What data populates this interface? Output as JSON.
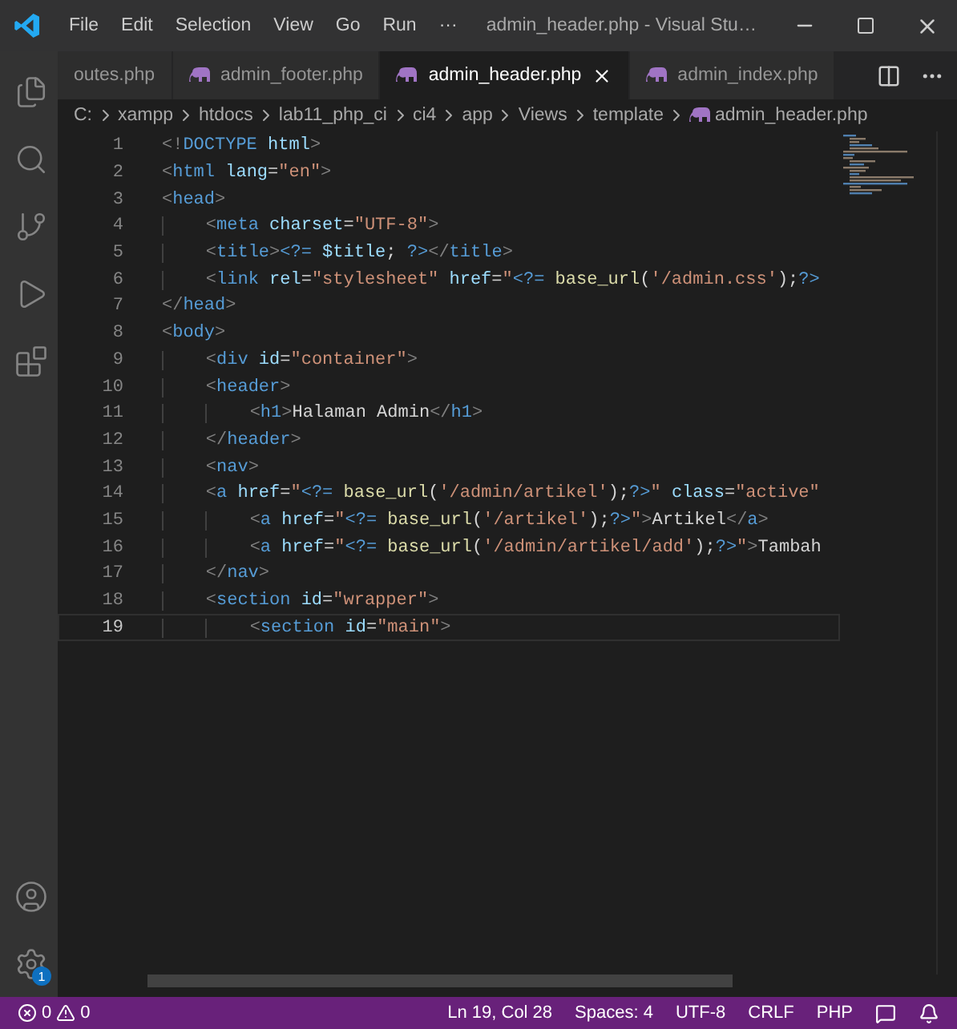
{
  "menu": [
    "File",
    "Edit",
    "Selection",
    "View",
    "Go",
    "Run",
    "···"
  ],
  "window": {
    "title": "admin_header.php - Visual Stu…"
  },
  "activity_bar": {
    "top": [
      {
        "kind": "files",
        "selected": false
      },
      {
        "kind": "search",
        "selected": false
      },
      {
        "kind": "source-control",
        "selected": false
      },
      {
        "kind": "run",
        "selected": false
      },
      {
        "kind": "extensions",
        "selected": false
      }
    ],
    "bottom": [
      {
        "kind": "account"
      },
      {
        "kind": "settings",
        "badge": "1"
      }
    ]
  },
  "tabs": [
    {
      "label": "outes.php",
      "icon": false,
      "selected": false
    },
    {
      "label": "admin_footer.php",
      "icon": true,
      "selected": false
    },
    {
      "label": "admin_header.php",
      "icon": true,
      "selected": true
    },
    {
      "label": "admin_index.php",
      "icon": true,
      "selected": false
    }
  ],
  "breadcrumb": [
    "C:",
    "xampp",
    "htdocs",
    "lab11_php_ci",
    "ci4",
    "app",
    "Views",
    "template",
    "admin_header.php"
  ],
  "lines": [
    {
      "number": "1",
      "selected": false,
      "tokens": [
        {
          "kind": "punct",
          "text": "<!"
        },
        {
          "kind": "tag",
          "text": "DOCTYPE"
        },
        {
          "kind": "attr",
          "text": " html"
        },
        {
          "kind": "punct",
          "text": ">"
        }
      ]
    },
    {
      "number": "2",
      "selected": false,
      "tokens": [
        {
          "kind": "punct",
          "text": "<"
        },
        {
          "kind": "tag",
          "text": "html"
        },
        {
          "kind": "attr",
          "text": " lang"
        },
        {
          "kind": "text",
          "text": "="
        },
        {
          "kind": "str",
          "text": "\"en\""
        },
        {
          "kind": "punct",
          "text": ">"
        }
      ]
    },
    {
      "number": "3",
      "selected": false,
      "tokens": [
        {
          "kind": "punct",
          "text": "<"
        },
        {
          "kind": "tag",
          "text": "head"
        },
        {
          "kind": "punct",
          "text": ">"
        }
      ]
    },
    {
      "number": "4",
      "selected": false,
      "tokens": [
        {
          "kind": "punct",
          "text": "    <"
        },
        {
          "kind": "tag",
          "text": "meta"
        },
        {
          "kind": "attr",
          "text": " charset"
        },
        {
          "kind": "text",
          "text": "="
        },
        {
          "kind": "str",
          "text": "\"UTF-8\""
        },
        {
          "kind": "punct",
          "text": ">"
        }
      ]
    },
    {
      "number": "5",
      "selected": false,
      "tokens": [
        {
          "kind": "punct",
          "text": "    <"
        },
        {
          "kind": "tag",
          "text": "title"
        },
        {
          "kind": "punct",
          "text": ">"
        },
        {
          "kind": "php",
          "text": "<?="
        },
        {
          "kind": "attr",
          "text": " $title"
        },
        {
          "kind": "text",
          "text": ";"
        },
        {
          "kind": "php",
          "text": " ?>"
        },
        {
          "kind": "punct",
          "text": "</"
        },
        {
          "kind": "tag",
          "text": "title"
        },
        {
          "kind": "punct",
          "text": ">"
        }
      ]
    },
    {
      "number": "6",
      "selected": false,
      "tokens": [
        {
          "kind": "punct",
          "text": "    <"
        },
        {
          "kind": "tag",
          "text": "link"
        },
        {
          "kind": "attr",
          "text": " rel"
        },
        {
          "kind": "text",
          "text": "="
        },
        {
          "kind": "str",
          "text": "\"stylesheet\""
        },
        {
          "kind": "attr",
          "text": " href"
        },
        {
          "kind": "text",
          "text": "="
        },
        {
          "kind": "str",
          "text": "\""
        },
        {
          "kind": "php",
          "text": "<?="
        },
        {
          "kind": "func",
          "text": " base_url"
        },
        {
          "kind": "text",
          "text": "("
        },
        {
          "kind": "str",
          "text": "'/admin.css'"
        },
        {
          "kind": "text",
          "text": ");"
        },
        {
          "kind": "php",
          "text": "?>"
        }
      ]
    },
    {
      "number": "7",
      "selected": false,
      "tokens": [
        {
          "kind": "punct",
          "text": "</"
        },
        {
          "kind": "tag",
          "text": "head"
        },
        {
          "kind": "punct",
          "text": ">"
        }
      ]
    },
    {
      "number": "8",
      "selected": false,
      "tokens": [
        {
          "kind": "punct",
          "text": "<"
        },
        {
          "kind": "tag",
          "text": "body"
        },
        {
          "kind": "punct",
          "text": ">"
        }
      ]
    },
    {
      "number": "9",
      "selected": false,
      "tokens": [
        {
          "kind": "punct",
          "text": "    <"
        },
        {
          "kind": "tag",
          "text": "div"
        },
        {
          "kind": "attr",
          "text": " id"
        },
        {
          "kind": "text",
          "text": "="
        },
        {
          "kind": "str",
          "text": "\"container\""
        },
        {
          "kind": "punct",
          "text": ">"
        }
      ]
    },
    {
      "number": "10",
      "selected": false,
      "tokens": [
        {
          "kind": "punct",
          "text": "    <"
        },
        {
          "kind": "tag",
          "text": "header"
        },
        {
          "kind": "punct",
          "text": ">"
        }
      ]
    },
    {
      "number": "11",
      "selected": false,
      "tokens": [
        {
          "kind": "punct",
          "text": "        <"
        },
        {
          "kind": "tag",
          "text": "h1"
        },
        {
          "kind": "punct",
          "text": ">"
        },
        {
          "kind": "text",
          "text": "Halaman Admin"
        },
        {
          "kind": "punct",
          "text": "</"
        },
        {
          "kind": "tag",
          "text": "h1"
        },
        {
          "kind": "punct",
          "text": ">"
        }
      ]
    },
    {
      "number": "12",
      "selected": false,
      "tokens": [
        {
          "kind": "punct",
          "text": "    </"
        },
        {
          "kind": "tag",
          "text": "header"
        },
        {
          "kind": "punct",
          "text": ">"
        }
      ]
    },
    {
      "number": "13",
      "selected": false,
      "tokens": [
        {
          "kind": "punct",
          "text": "    <"
        },
        {
          "kind": "tag",
          "text": "nav"
        },
        {
          "kind": "punct",
          "text": ">"
        }
      ]
    },
    {
      "number": "14",
      "selected": false,
      "tokens": [
        {
          "kind": "punct",
          "text": "    <"
        },
        {
          "kind": "tag",
          "text": "a"
        },
        {
          "kind": "attr",
          "text": " href"
        },
        {
          "kind": "text",
          "text": "="
        },
        {
          "kind": "str",
          "text": "\""
        },
        {
          "kind": "php",
          "text": "<?="
        },
        {
          "kind": "func",
          "text": " base_url"
        },
        {
          "kind": "text",
          "text": "("
        },
        {
          "kind": "str",
          "text": "'/admin/artikel'"
        },
        {
          "kind": "text",
          "text": ");"
        },
        {
          "kind": "php",
          "text": "?>"
        },
        {
          "kind": "str",
          "text": "\""
        },
        {
          "kind": "attr",
          "text": " class"
        },
        {
          "kind": "text",
          "text": "="
        },
        {
          "kind": "str",
          "text": "\"active\""
        }
      ]
    },
    {
      "number": "15",
      "selected": false,
      "tokens": [
        {
          "kind": "punct",
          "text": "        <"
        },
        {
          "kind": "tag",
          "text": "a"
        },
        {
          "kind": "attr",
          "text": " href"
        },
        {
          "kind": "text",
          "text": "="
        },
        {
          "kind": "str",
          "text": "\""
        },
        {
          "kind": "php",
          "text": "<?="
        },
        {
          "kind": "func",
          "text": " base_url"
        },
        {
          "kind": "text",
          "text": "("
        },
        {
          "kind": "str",
          "text": "'/artikel'"
        },
        {
          "kind": "text",
          "text": ");"
        },
        {
          "kind": "php",
          "text": "?>"
        },
        {
          "kind": "str",
          "text": "\""
        },
        {
          "kind": "punct",
          "text": ">"
        },
        {
          "kind": "text",
          "text": "Artikel"
        },
        {
          "kind": "punct",
          "text": "</"
        },
        {
          "kind": "tag",
          "text": "a"
        },
        {
          "kind": "punct",
          "text": ">"
        }
      ]
    },
    {
      "number": "16",
      "selected": false,
      "tokens": [
        {
          "kind": "punct",
          "text": "        <"
        },
        {
          "kind": "tag",
          "text": "a"
        },
        {
          "kind": "attr",
          "text": " href"
        },
        {
          "kind": "text",
          "text": "="
        },
        {
          "kind": "str",
          "text": "\""
        },
        {
          "kind": "php",
          "text": "<?="
        },
        {
          "kind": "func",
          "text": " base_url"
        },
        {
          "kind": "text",
          "text": "("
        },
        {
          "kind": "str",
          "text": "'/admin/artikel/add'"
        },
        {
          "kind": "text",
          "text": ");"
        },
        {
          "kind": "php",
          "text": "?>"
        },
        {
          "kind": "str",
          "text": "\""
        },
        {
          "kind": "punct",
          "text": ">"
        },
        {
          "kind": "text",
          "text": "Tambah"
        }
      ]
    },
    {
      "number": "17",
      "selected": false,
      "tokens": [
        {
          "kind": "punct",
          "text": "    </"
        },
        {
          "kind": "tag",
          "text": "nav"
        },
        {
          "kind": "punct",
          "text": ">"
        }
      ]
    },
    {
      "number": "18",
      "selected": false,
      "tokens": [
        {
          "kind": "punct",
          "text": "    <"
        },
        {
          "kind": "tag",
          "text": "section"
        },
        {
          "kind": "attr",
          "text": " id"
        },
        {
          "kind": "text",
          "text": "="
        },
        {
          "kind": "str",
          "text": "\"wrapper\""
        },
        {
          "kind": "punct",
          "text": ">"
        }
      ]
    },
    {
      "number": "19",
      "selected": true,
      "tokens": [
        {
          "kind": "punct",
          "text": "        <"
        },
        {
          "kind": "tag",
          "text": "section"
        },
        {
          "kind": "attr",
          "text": " id"
        },
        {
          "kind": "text",
          "text": "="
        },
        {
          "kind": "str",
          "text": "\"main\""
        },
        {
          "kind": "punct",
          "text": ">"
        }
      ]
    }
  ],
  "status_bar": {
    "errors": "0",
    "warnings": "0",
    "items": [
      "Ln 19, Col 28",
      "Spaces: 4",
      "UTF-8",
      "CRLF",
      "PHP"
    ]
  }
}
